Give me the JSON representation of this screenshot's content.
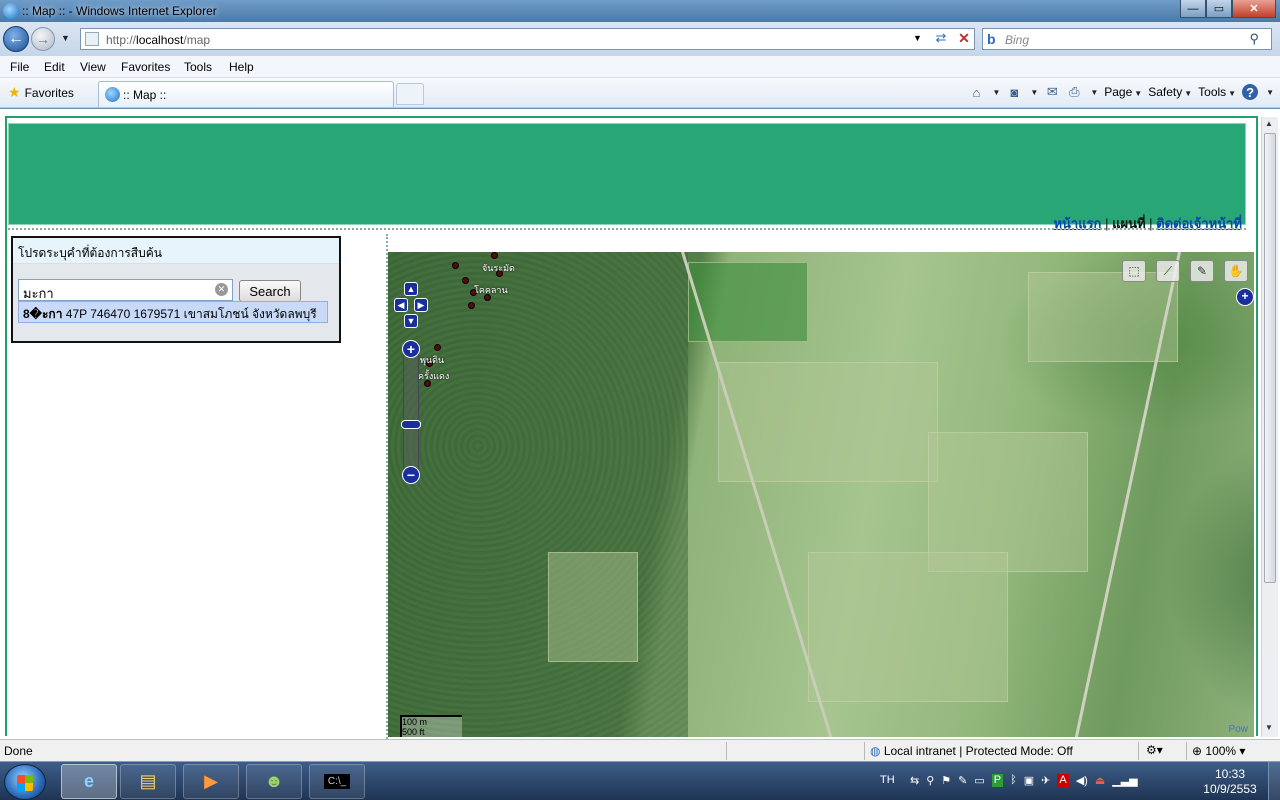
{
  "window": {
    "title": ":: Map :: - Windows Internet Explorer",
    "minimize": "—",
    "maximize": "▭",
    "close": "✕"
  },
  "address": {
    "url_prefix": "http://",
    "url_host": "localhost",
    "url_path": "/map",
    "search_placeholder": "Bing"
  },
  "menu": [
    "File",
    "Edit",
    "View",
    "Favorites",
    "Tools",
    "Help"
  ],
  "favbar": {
    "favorites_label": "Favorites",
    "tab_label": ":: Map ::",
    "commands": [
      "Page",
      "Safety",
      "Tools"
    ]
  },
  "page": {
    "nav": {
      "home": "หน้าแรก",
      "map": "แผนที่",
      "contact": "ติดต่อเจ้าหน้าที่",
      "separator": "|"
    },
    "search_panel": {
      "header": "โปรดระบุคำที่ต้องการสืบค้น",
      "input_value": "มะกา",
      "button_label": "Search",
      "suggestion_bold": "8�ะกา",
      "suggestion_rest": " 47P 746470 1679571 เขาสมโภชน์ จังหวัดลพบุรี"
    },
    "map": {
      "labels": [
        "จันระมัด",
        "โคคลาน",
        "พุนดิน",
        "ครั้งแดง"
      ],
      "scale": [
        "100 m",
        "500 ft"
      ],
      "powered": "Pow"
    }
  },
  "status": {
    "text": "Done",
    "zone": "Local intranet | Protected Mode: Off",
    "zoom": "100%"
  },
  "taskbar": {
    "language": "TH",
    "time": "10:33",
    "date": "10/9/2553"
  },
  "colors": {
    "header_green": "#28a676",
    "page_border": "#22a069",
    "link": "#0645ad"
  }
}
